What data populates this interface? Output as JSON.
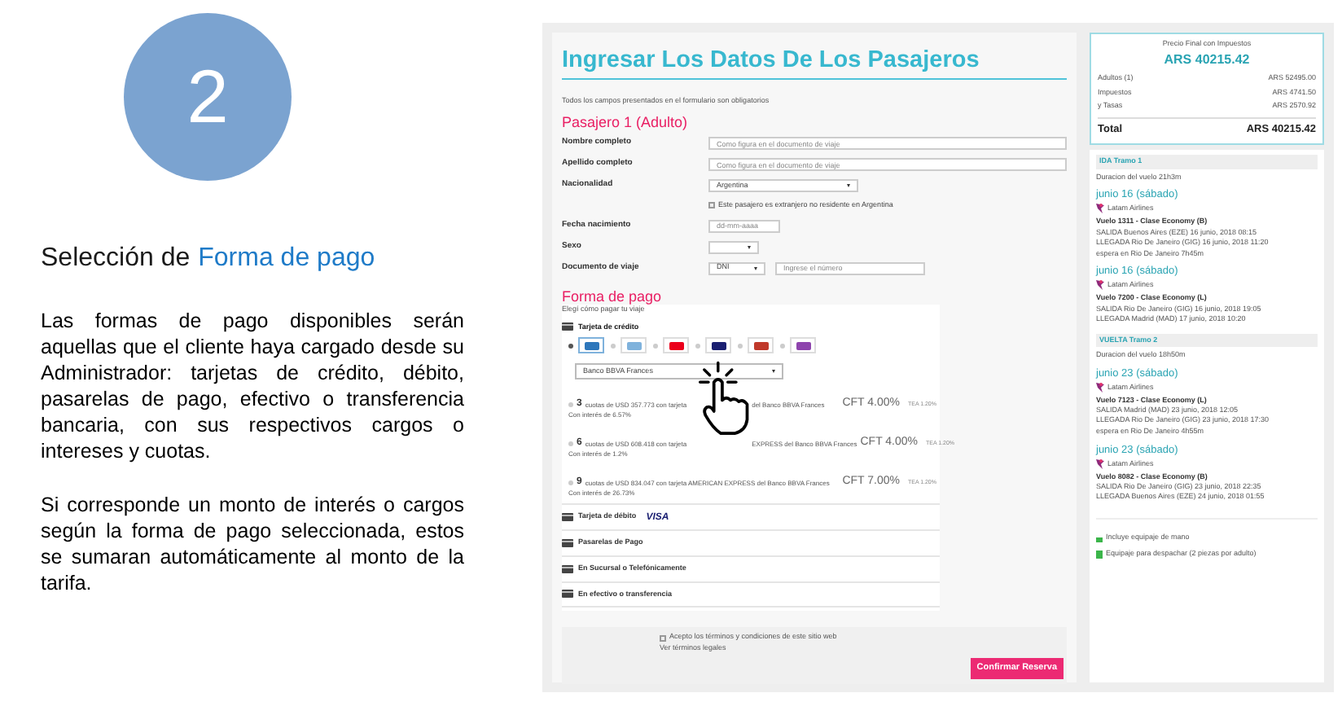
{
  "slide": {
    "step": "2",
    "heading": "Selección de",
    "heading_highlight": "Forma de pago",
    "paragraphs": [
      "Las formas de pago disponibles serán aquellas que el cliente haya cargado desde su Administrador: tarjetas de crédito, débito, pasarelas de pago, efectivo o transferencia bancaria, con sus respectivos cargos o intereses y cuotas.",
      "Si corresponde un monto de interés o cargos según la forma de pago seleccionada, estos se sumaran automáticamente al monto de la tarifa."
    ]
  },
  "form": {
    "title": "Ingresar Los Datos De Los Pasajeros",
    "note": "Todos los campos presentados en el formulario son obligatorios",
    "passenger": "Pasajero 1 (Adulto)",
    "fields": [
      {
        "kind": "text",
        "label": "Nombre completo",
        "placeholder": "Como figura en el documento de viaje"
      },
      {
        "kind": "text",
        "label": "Apellido completo",
        "placeholder": "Como figura en el documento de viaje"
      },
      {
        "kind": "select",
        "label": "Nacionalidad",
        "value": "Argentina"
      },
      {
        "kind": "checkbox",
        "text": "Este pasajero es extranjero no residente en Argentina",
        "checked": false
      },
      {
        "kind": "date",
        "label": "Fecha nacimiento",
        "placeholder": "dd-mm-aaaa"
      },
      {
        "kind": "select",
        "label": "Sexo"
      },
      {
        "kind": "document",
        "label": "Documento de viaje",
        "value": "DNI",
        "placeholder": "Ingrese el número"
      }
    ],
    "payment": {
      "title": "Forma de pago",
      "subtitle": "Elegí cómo pagar tu viaje",
      "methods": [
        {
          "label": "Tarjeta de crédito",
          "expanded": true,
          "cards": [
            {
              "selected": true,
              "color": "#2e77bb"
            },
            {
              "selected": false,
              "color": "#7fb2dc"
            },
            {
              "selected": false,
              "color": "#eb001b"
            },
            {
              "selected": false,
              "color": "#1a1f71"
            },
            {
              "selected": false,
              "color": "#c0392b"
            },
            {
              "selected": false,
              "color": "#8e44ad"
            }
          ],
          "bank": "Banco BBVA Frances",
          "installments": [
            {
              "count": "3",
              "text": "cuotas de USD 357.773 con tarjeta",
              "text_after": "del Banco BBVA Frances",
              "interest": "Con interés de 6.57%",
              "cft": "CFT 4.00%",
              "tea": "TEA 1.20%",
              "selected": false
            },
            {
              "count": "6",
              "text": "cuotas de USD 608.418 con tarjeta",
              "text_after": "EXPRESS del Banco BBVA Frances",
              "interest": "Con interés de 1.2%",
              "cft": "CFT 4.00%",
              "tea": "TEA 1.20%",
              "selected": false
            },
            {
              "count": "9",
              "text": "cuotas de USD 834.047 con tarjeta AMERICAN EXPRESS del Banco BBVA Frances",
              "interest": "Con interés de 26.73%",
              "cft": "CFT 7.00%",
              "tea": "TEA 1.20%",
              "selected": false
            }
          ]
        },
        {
          "label": "Tarjeta de débito",
          "expanded": false,
          "badge": "VISA"
        },
        {
          "label": "Pasarelas de Pago",
          "expanded": false
        },
        {
          "label": "En Sucursal o Telefónicamente",
          "expanded": false
        },
        {
          "label": "En efectivo o transferencia",
          "expanded": false
        }
      ]
    },
    "terms": {
      "text": "Acepto los términos y condiciones de este sitio web",
      "checked": false,
      "link": "Ver términos legales"
    },
    "submit": "Confirmar Reserva"
  },
  "summary": {
    "title": "Precio Final con Impuestos",
    "price": "ARS 40215.42",
    "lines": [
      {
        "label": "Adultos (1)",
        "value": "ARS 52495.00"
      },
      {
        "label": "Impuestos",
        "value": "ARS 4741.50"
      },
      {
        "label": "y Tasas",
        "value": "ARS 2570.92"
      }
    ],
    "total_label": "Total",
    "total_value": "ARS 40215.42"
  },
  "legs": [
    {
      "title": "IDA Tramo 1",
      "duration": "Duracion del vuelo 21h3m",
      "segments": [
        {
          "date": "junio 16 (sábado)",
          "airline": "Latam Airlines",
          "flight": "Vuelo 1311 - Clase Economy (B)",
          "lines": [
            "SALIDA Buenos Aires (EZE) 16 junio, 2018 08:15",
            "LLEGADA Rio De Janeiro (GIG) 16 junio, 2018 11:20"
          ],
          "wait": "espera en Rio De Janeiro 7h45m"
        },
        {
          "date": "junio 16 (sábado)",
          "airline": "Latam Airlines",
          "flight": "Vuelo 7200 - Clase Economy (L)",
          "lines": [
            "SALIDA Rio De Janeiro (GIG) 16 junio, 2018 19:05",
            "LLEGADA Madrid (MAD) 17 junio, 2018 10:20"
          ]
        }
      ]
    },
    {
      "title": "VUELTA Tramo 2",
      "duration": "Duracion del vuelo 18h50m",
      "segments": [
        {
          "date": "junio 23 (sábado)",
          "airline": "Latam Airlines",
          "flight": "Vuelo 7123 - Clase Economy (L)",
          "lines": [
            "SALIDA Madrid (MAD) 23 junio, 2018 12:05",
            "LLEGADA Rio De Janeiro (GIG) 23 junio, 2018 17:30"
          ],
          "wait": "espera en Rio De Janeiro 4h55m"
        },
        {
          "date": "junio 23 (sábado)",
          "airline": "Latam Airlines",
          "flight": "Vuelo 8082 - Clase Economy (B)",
          "lines": [
            "SALIDA Rio De Janeiro (GIG) 23 junio, 2018 22:35",
            "LLEGADA Buenos Aires (EZE) 24 junio, 2018 01:55"
          ]
        }
      ]
    }
  ],
  "baggage": [
    {
      "kind": "hand",
      "text": "Incluye equipaje de mano"
    },
    {
      "kind": "checked",
      "text": "Equipaje para despachar (2 piezas por adulto)"
    }
  ]
}
